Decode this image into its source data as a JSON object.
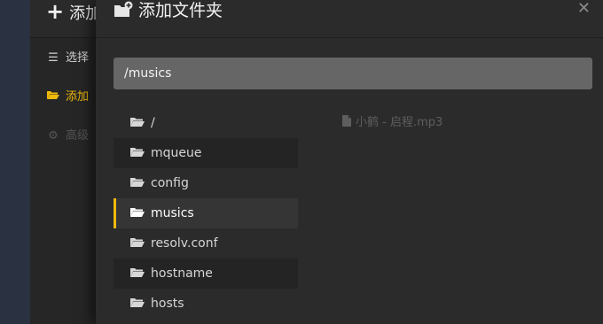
{
  "background": {
    "title": "添加",
    "nav": [
      {
        "label": "选择",
        "icon": "list-icon"
      },
      {
        "label": "添加",
        "icon": "folder-open-icon"
      },
      {
        "label": "高级",
        "icon": "gear-icon"
      }
    ]
  },
  "modal": {
    "title": "添加文件夹",
    "title_icon": "folder-plus-icon",
    "close_icon": "close-icon",
    "path_value": "/musics",
    "folders": [
      {
        "name": "/"
      },
      {
        "name": "mqueue"
      },
      {
        "name": "config"
      },
      {
        "name": "musics",
        "selected": true
      },
      {
        "name": "resolv.conf"
      },
      {
        "name": "hostname"
      },
      {
        "name": "hosts"
      }
    ],
    "files": [
      {
        "name": "小鹤 - 启程.mp3"
      }
    ]
  },
  "colors": {
    "accent": "#f0b90b",
    "modal_bg": "#2b2b2b",
    "input_bg": "#666666"
  }
}
